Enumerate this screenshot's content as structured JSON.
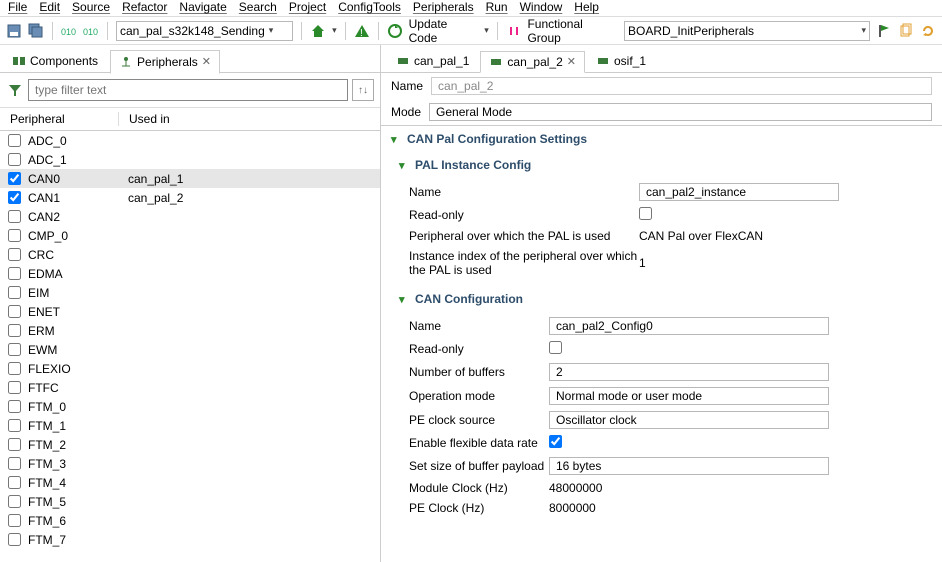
{
  "menu": {
    "file": "File",
    "edit": "Edit",
    "source": "Source",
    "refactor": "Refactor",
    "navigate": "Navigate",
    "search": "Search",
    "project": "Project",
    "configtools": "ConfigTools",
    "peripherals": "Peripherals",
    "run": "Run",
    "window": "Window",
    "help": "Help"
  },
  "toolbar": {
    "project_dropdown": "can_pal_s32k148_Sending",
    "update_code": "Update Code",
    "fg_label": "Functional Group",
    "fg_value": "BOARD_InitPeripherals"
  },
  "left": {
    "tab_components": "Components",
    "tab_peripherals": "Peripherals",
    "filter_placeholder": "type filter text",
    "col_peripheral": "Peripheral",
    "col_usedin": "Used in",
    "rows": [
      {
        "name": "ADC_0",
        "checked": false,
        "used": "",
        "sel": false
      },
      {
        "name": "ADC_1",
        "checked": false,
        "used": "",
        "sel": false
      },
      {
        "name": "CAN0",
        "checked": true,
        "used": "can_pal_1",
        "sel": true
      },
      {
        "name": "CAN1",
        "checked": true,
        "used": "can_pal_2",
        "sel": false
      },
      {
        "name": "CAN2",
        "checked": false,
        "used": "",
        "sel": false
      },
      {
        "name": "CMP_0",
        "checked": false,
        "used": "",
        "sel": false
      },
      {
        "name": "CRC",
        "checked": false,
        "used": "",
        "sel": false
      },
      {
        "name": "EDMA",
        "checked": false,
        "used": "",
        "sel": false
      },
      {
        "name": "EIM",
        "checked": false,
        "used": "",
        "sel": false
      },
      {
        "name": "ENET",
        "checked": false,
        "used": "",
        "sel": false
      },
      {
        "name": "ERM",
        "checked": false,
        "used": "",
        "sel": false
      },
      {
        "name": "EWM",
        "checked": false,
        "used": "",
        "sel": false
      },
      {
        "name": "FLEXIO",
        "checked": false,
        "used": "",
        "sel": false
      },
      {
        "name": "FTFC",
        "checked": false,
        "used": "",
        "sel": false
      },
      {
        "name": "FTM_0",
        "checked": false,
        "used": "",
        "sel": false
      },
      {
        "name": "FTM_1",
        "checked": false,
        "used": "",
        "sel": false
      },
      {
        "name": "FTM_2",
        "checked": false,
        "used": "",
        "sel": false
      },
      {
        "name": "FTM_3",
        "checked": false,
        "used": "",
        "sel": false
      },
      {
        "name": "FTM_4",
        "checked": false,
        "used": "",
        "sel": false
      },
      {
        "name": "FTM_5",
        "checked": false,
        "used": "",
        "sel": false
      },
      {
        "name": "FTM_6",
        "checked": false,
        "used": "",
        "sel": false
      },
      {
        "name": "FTM_7",
        "checked": false,
        "used": "",
        "sel": false
      }
    ]
  },
  "right": {
    "tabs": [
      {
        "label": "can_pal_1",
        "active": false
      },
      {
        "label": "can_pal_2",
        "active": true
      },
      {
        "label": "osif_1",
        "active": false
      }
    ],
    "name_label": "Name",
    "name_value": "can_pal_2",
    "mode_label": "Mode",
    "mode_value": "General Mode",
    "section_main": "CAN Pal Configuration Settings",
    "section_instance": "PAL Instance Config",
    "instance": {
      "name_label": "Name",
      "name_value": "can_pal2_instance",
      "readonly_label": "Read-only",
      "readonly_checked": false,
      "periph_over_label": "Peripheral over which the PAL is used",
      "periph_over_value": "CAN Pal over FlexCAN",
      "instance_idx_label": "Instance index of the peripheral over which the PAL is used",
      "instance_idx_value": "1"
    },
    "section_can": "CAN Configuration",
    "can": {
      "name_label": "Name",
      "name_value": "can_pal2_Config0",
      "readonly_label": "Read-only",
      "readonly_checked": false,
      "nbuf_label": "Number of buffers",
      "nbuf_value": "2",
      "opmode_label": "Operation mode",
      "opmode_value": "Normal mode or user mode",
      "peclk_label": "PE clock source",
      "peclk_value": "Oscillator clock",
      "flex_label": "Enable flexible data rate",
      "flex_checked": true,
      "payload_label": "Set size of buffer payload",
      "payload_value": "16 bytes",
      "mclk_label": "Module Clock (Hz)",
      "mclk_value": "48000000",
      "pclk_label": "PE Clock (Hz)",
      "pclk_value": "8000000"
    }
  }
}
